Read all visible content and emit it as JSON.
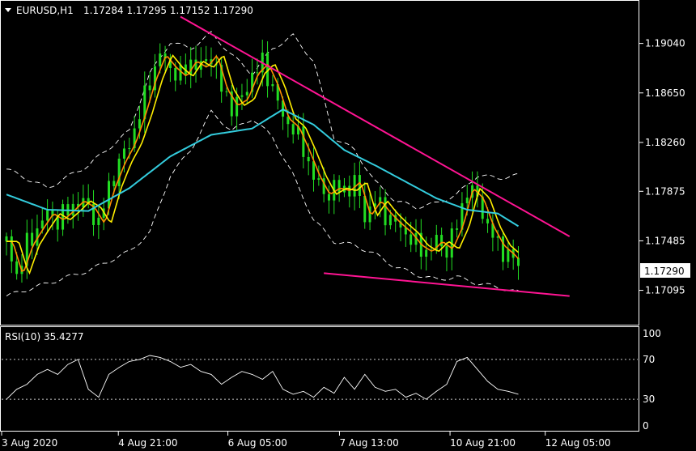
{
  "header": {
    "symbol": "EURUSD,H1",
    "ohlc": "1.17284 1.17295 1.17152 1.17290"
  },
  "rsi_header": {
    "label": "RSI(10) 35.4277"
  },
  "colors": {
    "background": "#000000",
    "frame": "#ffffff",
    "candles": "#22dd22",
    "ma_fast": "#ff8c00",
    "ma_mid": "#ffee00",
    "ma_slow": "#33ccdd",
    "bands": "#ffffff",
    "trendlines": "#ff1493",
    "rsi": "#ffffff",
    "price_box_bg": "#ffffff",
    "price_box_text": "#000000"
  },
  "chart_data": {
    "type": "candlestick",
    "symbol": "EURUSD",
    "timeframe": "H1",
    "current_price": "1.17290",
    "price_axis": {
      "ticks": [
        "1.19040",
        "1.18650",
        "1.18260",
        "1.17875",
        "1.17485",
        "1.17095"
      ],
      "ylim": [
        1.1685,
        1.1935
      ]
    },
    "time_axis": {
      "ticks": [
        "3 Aug 2020",
        "4 Aug 21:00",
        "6 Aug 05:00",
        "7 Aug 13:00",
        "10 Aug 21:00",
        "12 Aug 05:00"
      ]
    },
    "close_path": [
      [
        0,
        1.1748
      ],
      [
        1,
        1.1722
      ],
      [
        2,
        1.1745
      ],
      [
        3,
        1.1758
      ],
      [
        4,
        1.177
      ],
      [
        5,
        1.1765
      ],
      [
        6,
        1.1772
      ],
      [
        7,
        1.178
      ],
      [
        8,
        1.1775
      ],
      [
        9,
        1.1762
      ],
      [
        10,
        1.179
      ],
      [
        11,
        1.181
      ],
      [
        12,
        1.1825
      ],
      [
        13,
        1.1848
      ],
      [
        14,
        1.1875
      ],
      [
        15,
        1.1895
      ],
      [
        16,
        1.1885
      ],
      [
        17,
        1.1878
      ],
      [
        18,
        1.189
      ],
      [
        19,
        1.1885
      ],
      [
        20,
        1.1895
      ],
      [
        21,
        1.1868
      ],
      [
        22,
        1.1855
      ],
      [
        23,
        1.186
      ],
      [
        24,
        1.188
      ],
      [
        25,
        1.1888
      ],
      [
        26,
        1.187
      ],
      [
        27,
        1.1845
      ],
      [
        28,
        1.1838
      ],
      [
        29,
        1.182
      ],
      [
        30,
        1.18
      ],
      [
        31,
        1.1785
      ],
      [
        32,
        1.179
      ],
      [
        33,
        1.1788
      ],
      [
        34,
        1.1795
      ],
      [
        35,
        1.1768
      ],
      [
        36,
        1.178
      ],
      [
        37,
        1.177
      ],
      [
        38,
        1.1762
      ],
      [
        39,
        1.1755
      ],
      [
        40,
        1.1745
      ],
      [
        41,
        1.174
      ],
      [
        42,
        1.1748
      ],
      [
        43,
        1.1742
      ],
      [
        44,
        1.176
      ],
      [
        45,
        1.179
      ],
      [
        46,
        1.1782
      ],
      [
        47,
        1.176
      ],
      [
        48,
        1.1745
      ],
      [
        49,
        1.1738
      ],
      [
        50,
        1.1729
      ]
    ],
    "ma_slow_path": [
      [
        0,
        1.1785
      ],
      [
        4,
        1.1773
      ],
      [
        8,
        1.1772
      ],
      [
        12,
        1.179
      ],
      [
        16,
        1.1815
      ],
      [
        20,
        1.1832
      ],
      [
        24,
        1.1837
      ],
      [
        27,
        1.1852
      ],
      [
        30,
        1.184
      ],
      [
        33,
        1.182
      ],
      [
        36,
        1.1808
      ],
      [
        39,
        1.1795
      ],
      [
        42,
        1.1782
      ],
      [
        45,
        1.1773
      ],
      [
        48,
        1.177
      ],
      [
        50,
        1.176
      ]
    ],
    "upper_band_path": [
      [
        0,
        1.1805
      ],
      [
        4,
        1.179
      ],
      [
        8,
        1.1808
      ],
      [
        12,
        1.1835
      ],
      [
        14,
        1.188
      ],
      [
        16,
        1.1905
      ],
      [
        18,
        1.19
      ],
      [
        20,
        1.1912
      ],
      [
        22,
        1.1895
      ],
      [
        24,
        1.188
      ],
      [
        26,
        1.19
      ],
      [
        28,
        1.191
      ],
      [
        30,
        1.189
      ],
      [
        32,
        1.183
      ],
      [
        34,
        1.182
      ],
      [
        36,
        1.1795
      ],
      [
        38,
        1.178
      ],
      [
        40,
        1.1775
      ],
      [
        42,
        1.1778
      ],
      [
        44,
        1.1785
      ],
      [
        46,
        1.18
      ],
      [
        48,
        1.1798
      ],
      [
        50,
        1.18
      ]
    ],
    "lower_band_path": [
      [
        0,
        1.1705
      ],
      [
        4,
        1.1715
      ],
      [
        8,
        1.1725
      ],
      [
        12,
        1.174
      ],
      [
        14,
        1.1755
      ],
      [
        16,
        1.18
      ],
      [
        18,
        1.182
      ],
      [
        20,
        1.185
      ],
      [
        22,
        1.1835
      ],
      [
        24,
        1.1845
      ],
      [
        26,
        1.183
      ],
      [
        28,
        1.18
      ],
      [
        30,
        1.1765
      ],
      [
        32,
        1.1748
      ],
      [
        34,
        1.1745
      ],
      [
        36,
        1.1738
      ],
      [
        38,
        1.1728
      ],
      [
        40,
        1.1722
      ],
      [
        42,
        1.1718
      ],
      [
        44,
        1.172
      ],
      [
        46,
        1.1715
      ],
      [
        48,
        1.1712
      ],
      [
        50,
        1.1708
      ]
    ],
    "trendlines": [
      {
        "from": [
          17,
          1.1925
        ],
        "to": [
          55,
          1.1752
        ]
      },
      {
        "from": [
          31,
          1.1723
        ],
        "to": [
          55,
          1.1705
        ]
      }
    ],
    "rsi": {
      "period": 10,
      "value": "35.4277",
      "axis_ticks": [
        "100",
        "70",
        "30",
        "0"
      ],
      "levels": [
        70,
        30
      ],
      "ylim": [
        0,
        100
      ],
      "values": [
        [
          0,
          30
        ],
        [
          1,
          40
        ],
        [
          2,
          45
        ],
        [
          3,
          55
        ],
        [
          4,
          60
        ],
        [
          5,
          55
        ],
        [
          6,
          65
        ],
        [
          7,
          70
        ],
        [
          8,
          40
        ],
        [
          9,
          32
        ],
        [
          10,
          55
        ],
        [
          11,
          62
        ],
        [
          12,
          68
        ],
        [
          13,
          70
        ],
        [
          14,
          74
        ],
        [
          15,
          72
        ],
        [
          16,
          68
        ],
        [
          17,
          62
        ],
        [
          18,
          65
        ],
        [
          19,
          58
        ],
        [
          20,
          55
        ],
        [
          21,
          45
        ],
        [
          22,
          52
        ],
        [
          23,
          58
        ],
        [
          24,
          55
        ],
        [
          25,
          50
        ],
        [
          26,
          58
        ],
        [
          27,
          40
        ],
        [
          28,
          35
        ],
        [
          29,
          38
        ],
        [
          30,
          32
        ],
        [
          31,
          42
        ],
        [
          32,
          36
        ],
        [
          33,
          52
        ],
        [
          34,
          40
        ],
        [
          35,
          55
        ],
        [
          36,
          42
        ],
        [
          37,
          38
        ],
        [
          38,
          40
        ],
        [
          39,
          32
        ],
        [
          40,
          36
        ],
        [
          41,
          30
        ],
        [
          42,
          38
        ],
        [
          43,
          45
        ],
        [
          44,
          68
        ],
        [
          45,
          72
        ],
        [
          46,
          60
        ],
        [
          47,
          48
        ],
        [
          48,
          40
        ],
        [
          49,
          38
        ],
        [
          50,
          35
        ]
      ]
    }
  }
}
